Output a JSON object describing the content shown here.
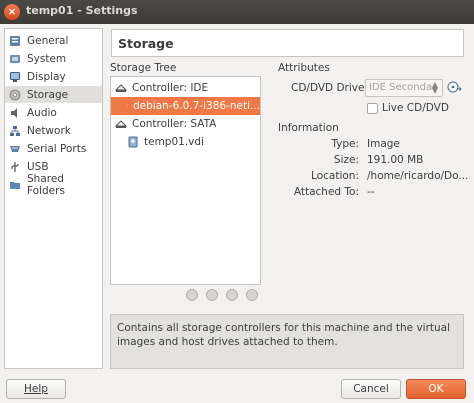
{
  "window": {
    "title": "temp01 - Settings",
    "close_glyph": "×"
  },
  "sidebar": {
    "items": [
      {
        "label": "General",
        "icon": "general-icon"
      },
      {
        "label": "System",
        "icon": "system-icon"
      },
      {
        "label": "Display",
        "icon": "display-icon"
      },
      {
        "label": "Storage",
        "icon": "storage-icon",
        "selected": true
      },
      {
        "label": "Audio",
        "icon": "audio-icon"
      },
      {
        "label": "Network",
        "icon": "network-icon"
      },
      {
        "label": "Serial Ports",
        "icon": "serial-ports-icon"
      },
      {
        "label": "USB",
        "icon": "usb-icon"
      },
      {
        "label": "Shared Folders",
        "icon": "shared-folders-icon"
      }
    ]
  },
  "page": {
    "title": "Storage"
  },
  "storage_tree": {
    "heading": "Storage Tree",
    "rows": [
      {
        "label": "Controller: IDE",
        "type": "controller"
      },
      {
        "label": "debian-6.0.7-i386-neti...",
        "type": "disc",
        "selected": true
      },
      {
        "label": "Controller: SATA",
        "type": "controller"
      },
      {
        "label": "temp01.vdi",
        "type": "disk"
      }
    ]
  },
  "attributes": {
    "heading": "Attributes",
    "drive_label": "CD/DVD Drive:",
    "drive_value": "IDE Secondar",
    "live_label": "Live CD/DVD",
    "live_checked": false
  },
  "information": {
    "heading": "Information",
    "rows": [
      {
        "key": "Type:",
        "value": "Image"
      },
      {
        "key": "Size:",
        "value": "191.00 MB"
      },
      {
        "key": "Location:",
        "value": "/home/ricardo/Do..."
      },
      {
        "key": "Attached To:",
        "value": "--"
      }
    ]
  },
  "description": "Contains all storage controllers for this machine and the virtual images and host drives attached to them.",
  "buttons": {
    "help": "Help",
    "cancel": "Cancel",
    "ok": "OK"
  },
  "colors": {
    "accent": "#f07746",
    "titlebar": "#3c3b37"
  }
}
